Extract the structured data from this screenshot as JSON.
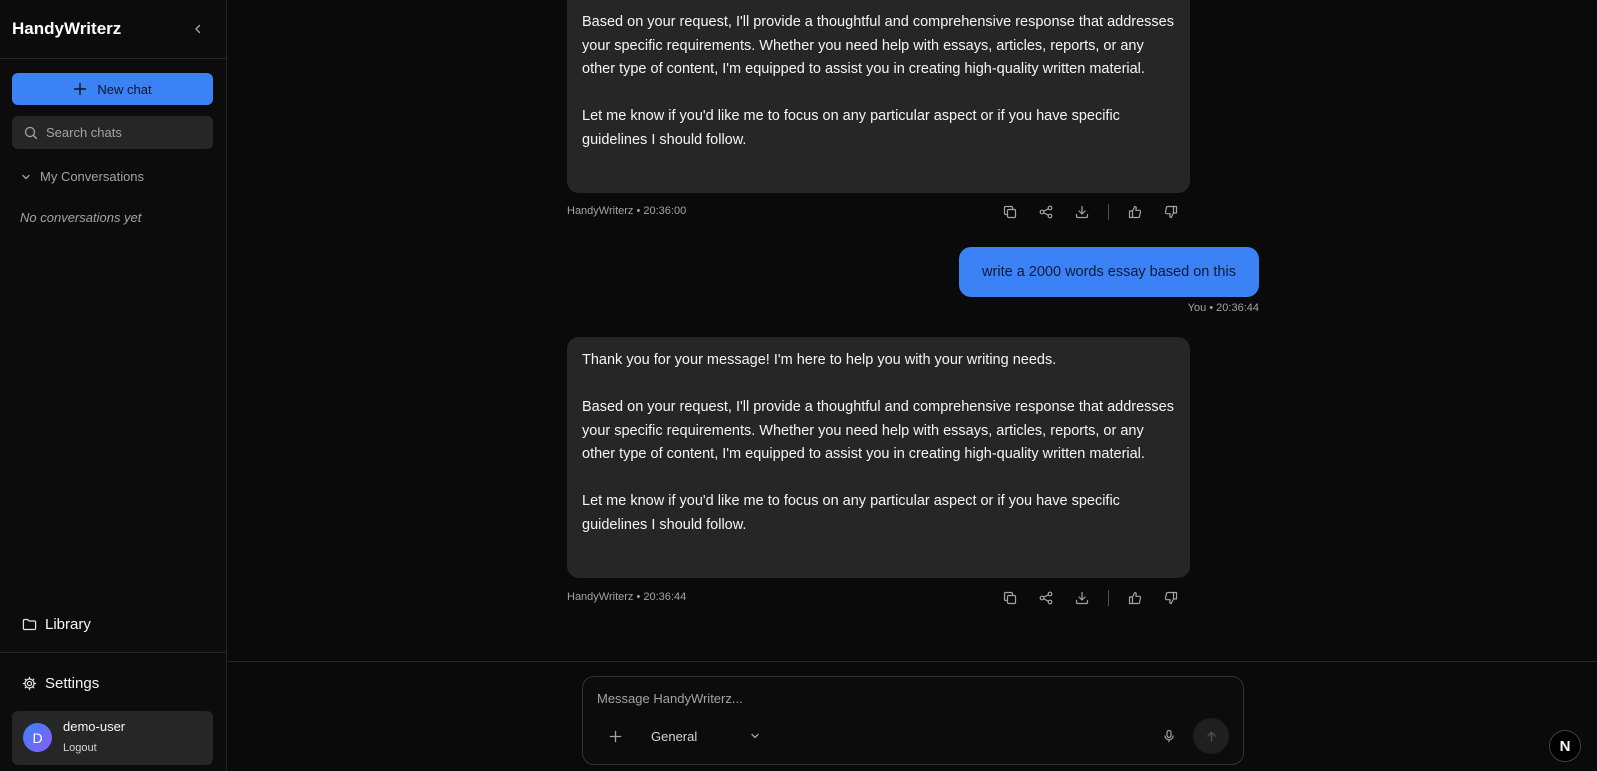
{
  "sidebar": {
    "brand": "HandyWriterz",
    "new_chat_label": "New chat",
    "search_placeholder": "Search chats",
    "section_label": "My Conversations",
    "empty_text": "No conversations yet",
    "library_label": "Library",
    "settings_label": "Settings",
    "user": {
      "initial": "D",
      "name": "demo-user",
      "logout_label": "Logout"
    }
  },
  "messages": [
    {
      "role": "assistant",
      "paragraphs": [
        "Based on your request, I'll provide a thoughtful and comprehensive response that addresses your specific requirements. Whether you need help with essays, articles, reports, or any other type of content, I'm equipped to assist you in creating high-quality written material.",
        "Let me know if you'd like me to focus on any particular aspect or if you have specific guidelines I should follow."
      ],
      "meta": "HandyWriterz • 20:36:00"
    },
    {
      "role": "user",
      "text": "write a 2000 words essay based on this",
      "meta": "You • 20:36:44"
    },
    {
      "role": "assistant",
      "paragraphs": [
        "Thank you for your message! I'm here to help you with your writing needs.",
        "Based on your request, I'll provide a thoughtful and comprehensive response that addresses your specific requirements. Whether you need help with essays, articles, reports, or any other type of content, I'm equipped to assist you in creating high-quality written material.",
        "Let me know if you'd like me to focus on any particular aspect or if you have specific guidelines I should follow."
      ],
      "meta": "HandyWriterz • 20:36:44"
    }
  ],
  "message_actions": [
    "copy-icon",
    "share-icon",
    "download-icon",
    "thumbs-up-icon",
    "thumbs-down-icon"
  ],
  "composer": {
    "placeholder": "Message HandyWriterz...",
    "mode": "General"
  },
  "badge": "N",
  "colors": {
    "accent": "#3b82f6",
    "background": "#0a0a0a",
    "bubble": "#262626"
  }
}
